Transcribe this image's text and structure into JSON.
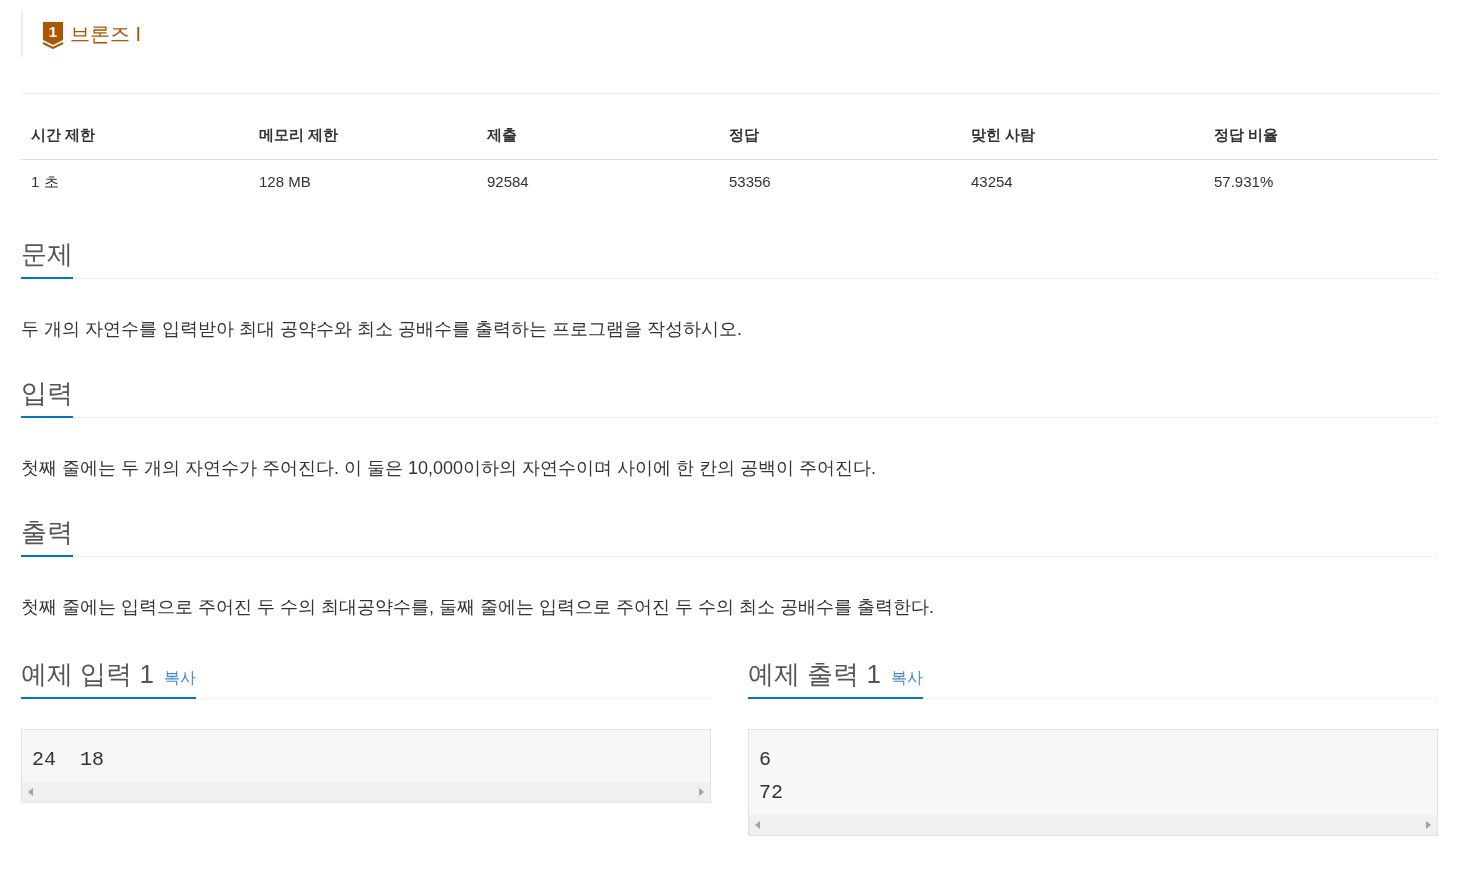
{
  "tier": {
    "number": "1",
    "label": "브론즈 I"
  },
  "limits_table": {
    "columns": [
      "시간 제한",
      "메모리 제한",
      "제출",
      "정답",
      "맞힌 사람",
      "정답 비율"
    ],
    "rows": [
      [
        "1 초",
        "128 MB",
        "92584",
        "53356",
        "43254",
        "57.931%"
      ]
    ]
  },
  "sections": [
    {
      "heading": "문제",
      "text": "두 개의 자연수를 입력받아 최대 공약수와 최소 공배수를 출력하는 프로그램을 작성하시오."
    },
    {
      "heading": "입력",
      "text": "첫째 줄에는 두 개의 자연수가 주어진다. 이 둘은 10,000이하의 자연수이며 사이에 한 칸의 공백이 주어진다."
    },
    {
      "heading": "출력",
      "text": "첫째 줄에는 입력으로 주어진 두 수의 최대공약수를, 둘째 줄에는 입력으로 주어진 두 수의 최소 공배수를 출력한다."
    }
  ],
  "samples": [
    {
      "heading": "예제 입력 1",
      "copy": "복사",
      "lines": [
        "24  18"
      ]
    },
    {
      "heading": "예제 출력 1",
      "copy": "복사",
      "lines": [
        "6",
        "72"
      ]
    }
  ]
}
